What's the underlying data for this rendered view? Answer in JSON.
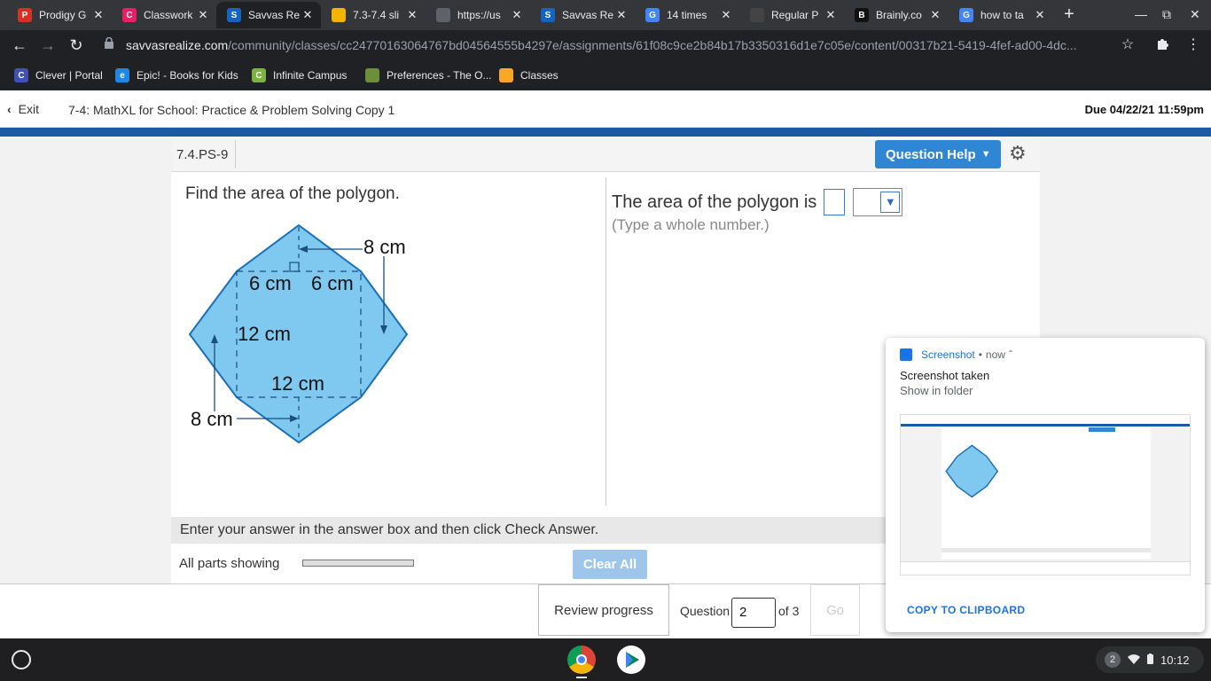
{
  "browser": {
    "tabs": [
      {
        "label": "Prodigy G",
        "color": "#d93025",
        "glyph": "P",
        "active": false
      },
      {
        "label": "Classwork",
        "color": "#e91e63",
        "glyph": "C",
        "active": false
      },
      {
        "label": "Savvas Re",
        "color": "#1565c0",
        "glyph": "S",
        "active": true
      },
      {
        "label": "7.3-7.4 sli",
        "color": "#f4b400",
        "glyph": "",
        "active": false
      },
      {
        "label": "https://us",
        "color": "#5f6368",
        "glyph": "",
        "active": false
      },
      {
        "label": "Savvas Re",
        "color": "#1565c0",
        "glyph": "S",
        "active": false
      },
      {
        "label": "14 times",
        "color": "#4285f4",
        "glyph": "G",
        "active": false
      },
      {
        "label": "Regular P",
        "color": "#444444",
        "glyph": "",
        "active": false
      },
      {
        "label": "Brainly.co",
        "color": "#111111",
        "glyph": "B",
        "active": false
      },
      {
        "label": "how to ta",
        "color": "#4285f4",
        "glyph": "G",
        "active": false
      }
    ],
    "url_domain": "savvasrealize.com",
    "url_path": "/community/classes/cc24770163064767bd04564555b4297e/assignments/61f08c9ce2b84b17b3350316d1e7c05e/content/00317b21-5419-4fef-ad00-4dc...",
    "bookmarks": [
      {
        "label": "Clever | Portal",
        "color": "#3f51b5",
        "glyph": "C"
      },
      {
        "label": "Epic! - Books for Kids",
        "color": "#1e88e5",
        "glyph": "e"
      },
      {
        "label": "Infinite Campus",
        "color": "#7cb342",
        "glyph": "C"
      },
      {
        "label": "Preferences - The O...",
        "color": "#6d8e3a",
        "glyph": ""
      },
      {
        "label": "Classes",
        "color": "#f9a825",
        "glyph": ""
      }
    ]
  },
  "app": {
    "exit_label": "Exit",
    "assignment_title": "7-4: MathXL for School: Practice & Problem Solving Copy 1",
    "due": "Due 04/22/21 11:59pm"
  },
  "question": {
    "id": "7.4.PS-9",
    "help_label": "Question Help",
    "prompt": "Find the area of the polygon.",
    "answer_prefix": "The area of the polygon is",
    "answer_value": "",
    "hint": "(Type a whole number.)",
    "figure_labels": {
      "top_dim": "8 cm",
      "left_half": "6 cm",
      "right_half": "6 cm",
      "height": "12 cm",
      "width": "12 cm",
      "bottom_dim": "8 cm"
    },
    "instruction": "Enter your answer in the answer box and then click Check Answer.",
    "parts_label": "All parts showing",
    "clear_label": "Clear All"
  },
  "footer": {
    "review_label": "Review progress",
    "question_label": "Question",
    "question_number": "2",
    "of_label": "of 3",
    "go_label": "Go"
  },
  "notification": {
    "app": "Screenshot",
    "time": "now",
    "title": "Screenshot taken",
    "subtitle": "Show in folder",
    "action": "COPY TO CLIPBOARD"
  },
  "shelf": {
    "notif_count": "2",
    "time": "10:12"
  },
  "colors": {
    "accent_blue": "#2f86d4",
    "header_bar": "#1a5ba6",
    "polygon_fill": "#7fc8ef",
    "polygon_stroke": "#1a6fb5"
  }
}
